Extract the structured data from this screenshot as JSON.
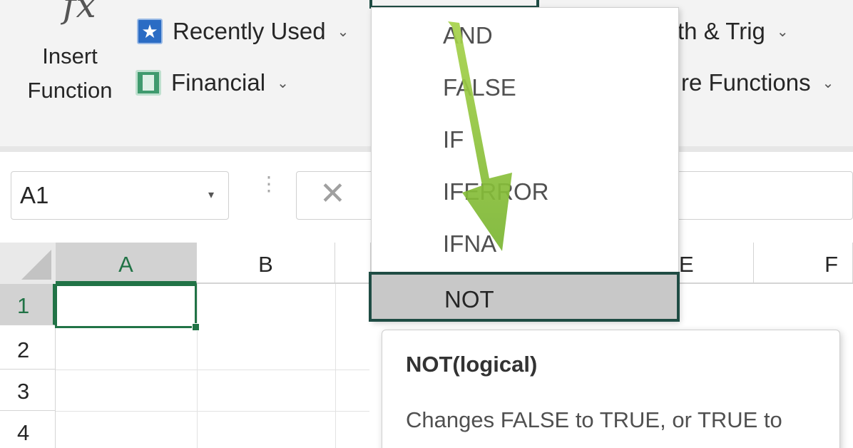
{
  "ribbon": {
    "insert_function": {
      "label": "Insert Function",
      "icon": "fx-icon",
      "glyph": "fx"
    },
    "recently_used": {
      "label": "Recently Used",
      "icon": "star-icon"
    },
    "financial": {
      "label": "Financial",
      "icon": "book-icon"
    },
    "math_trig": {
      "label": "th & Trig"
    },
    "more_functions": {
      "label": "re Functions"
    },
    "chevron": "⌄"
  },
  "formula_bar": {
    "name_box": "A1",
    "name_box_caret": "▾",
    "cancel_glyph": "✕",
    "dots": "⋮"
  },
  "grid": {
    "columns": [
      "A",
      "B",
      "E",
      "F"
    ],
    "active_column": "A",
    "rows": [
      "1",
      "2",
      "3",
      "4"
    ],
    "active_row": "1",
    "active_cell": "A1",
    "accent_color": "#217346"
  },
  "dropdown": {
    "items": [
      "AND",
      "FALSE",
      "IF",
      "IFERROR",
      "IFNA",
      "NOT"
    ],
    "hovered": "NOT",
    "highlight_color": "#1f4c44"
  },
  "tooltip": {
    "title": "NOT(logical)",
    "description": "Changes FALSE to TRUE, or TRUE to"
  },
  "annotation": {
    "arrow_color": "#8dc63f"
  }
}
